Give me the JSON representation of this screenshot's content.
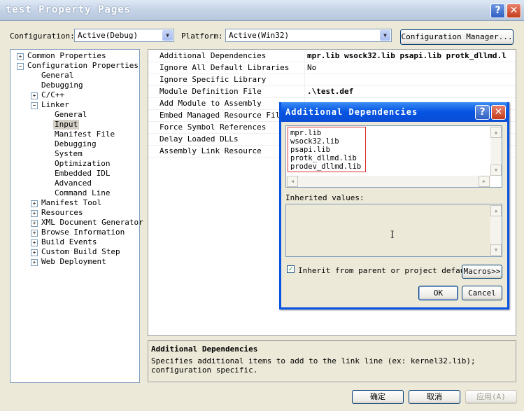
{
  "window": {
    "title": "test Property Pages"
  },
  "toolbar": {
    "config_label": "Configuration:",
    "config_value": "Active(Debug)",
    "platform_label": "Platform:",
    "platform_value": "Active(Win32)",
    "config_manager": "Configuration Manager..."
  },
  "tree": {
    "common": "Common Properties",
    "config": "Configuration Properties",
    "general": "General",
    "debugging": "Debugging",
    "cpp": "C/C++",
    "linker": "Linker",
    "linker_children": [
      "General",
      "Input",
      "Manifest File",
      "Debugging",
      "System",
      "Optimization",
      "Embedded IDL",
      "Advanced",
      "Command Line"
    ],
    "others": [
      "Manifest Tool",
      "Resources",
      "XML Document Generator",
      "Browse Information",
      "Build Events",
      "Custom Build Step",
      "Web Deployment"
    ]
  },
  "grid": {
    "rows": [
      {
        "name": "Additional Dependencies",
        "value": "mpr.lib wsock32.lib psapi.lib protk_dllmd.l"
      },
      {
        "name": "Ignore All Default Libraries",
        "value": "No"
      },
      {
        "name": "Ignore Specific Library",
        "value": ""
      },
      {
        "name": "Module Definition File",
        "value": ".\\test.def"
      },
      {
        "name": "Add Module to Assembly",
        "value": ""
      },
      {
        "name": "Embed Managed Resource File",
        "value": ""
      },
      {
        "name": "Force Symbol References",
        "value": ""
      },
      {
        "name": "Delay Loaded DLLs",
        "value": ""
      },
      {
        "name": "Assembly Link Resource",
        "value": ""
      }
    ]
  },
  "description": {
    "title": "Additional Dependencies",
    "text": "Specifies additional items to add to the link line (ex: kernel32.lib); configuration specific."
  },
  "dialog": {
    "title": "Additional Dependencies",
    "libs": [
      "mpr.lib",
      "wsock32.lib",
      "psapi.lib",
      "protk_dllmd.lib",
      "prodev_dllmd.lib"
    ],
    "inherited_label": "Inherited values:",
    "inherit_checkbox": "Inherit from parent or project default",
    "macros": "Macros>>",
    "ok": "OK",
    "cancel": "Cancel"
  },
  "footer": {
    "ok": "确定",
    "cancel": "取消",
    "apply": "应用(A)"
  },
  "colors": {
    "highlight_box": "#d93030",
    "dialog_title": "#0554e3"
  }
}
